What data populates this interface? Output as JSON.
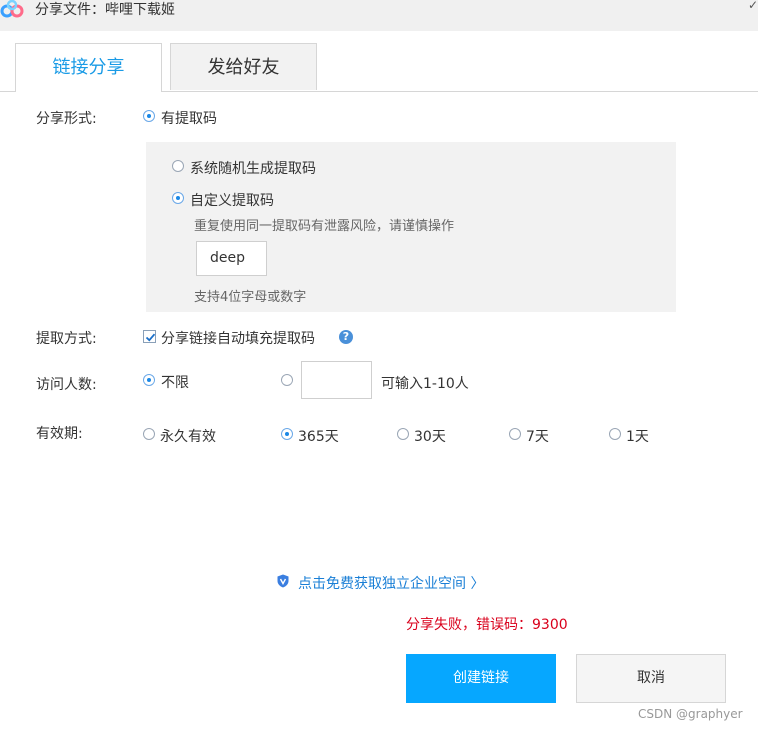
{
  "window": {
    "title": "分享文件：哔哩下载姬",
    "corner": "✓"
  },
  "tabs": [
    {
      "label": "链接分享",
      "active": true
    },
    {
      "label": "发给好友",
      "active": false
    }
  ],
  "share_form": {
    "label": "分享形式:",
    "option": "有提取码",
    "panel": {
      "random": "系统随机生成提取码",
      "custom": "自定义提取码",
      "warning": "重复使用同一提取码有泄露风险，请谨慎操作",
      "code_value": "deep",
      "hint": "支持4位字母或数字"
    }
  },
  "extract_method": {
    "label": "提取方式:",
    "checkbox": "分享链接自动填充提取码",
    "checked": true,
    "help": "?"
  },
  "visitors": {
    "label": "访问人数:",
    "unlimited": "不限",
    "limit_hint": "可输入1-10人",
    "limit_value": ""
  },
  "validity": {
    "label": "有效期:",
    "options": [
      "永久有效",
      "365天",
      "30天",
      "7天",
      "1天"
    ],
    "selected": "365天"
  },
  "promo": {
    "text": "点击免费获取独立企业空间 〉"
  },
  "error": {
    "text": "分享失败，错误码：9300"
  },
  "buttons": {
    "create": "创建链接",
    "cancel": "取消"
  },
  "watermark": "CSDN @graphyer",
  "colors": {
    "accent": "#06a7ff",
    "tab_active": "#1a9be6",
    "error": "#d9001b",
    "link": "#1a7fd6"
  }
}
